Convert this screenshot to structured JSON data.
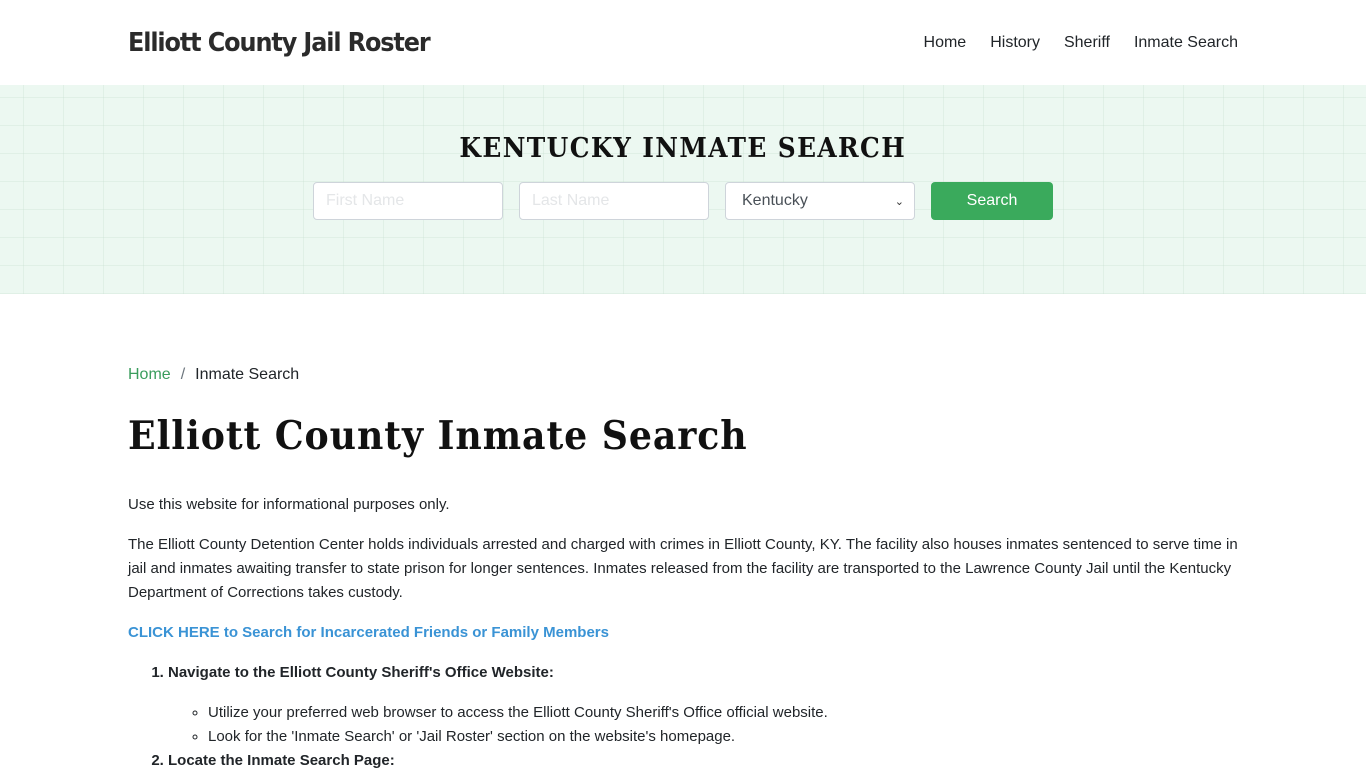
{
  "header": {
    "brand": "Elliott County Jail Roster",
    "nav": [
      {
        "label": "Home"
      },
      {
        "label": "History"
      },
      {
        "label": "Sheriff"
      },
      {
        "label": "Inmate Search"
      }
    ]
  },
  "hero": {
    "title": "KENTUCKY INMATE SEARCH",
    "first_name_placeholder": "First Name",
    "last_name_placeholder": "Last Name",
    "state_selected": "Kentucky",
    "search_label": "Search",
    "accent_color": "#3aaa5c",
    "background_color": "#ecf8f1"
  },
  "breadcrumb": {
    "home": "Home",
    "separator": "/",
    "current": "Inmate Search"
  },
  "main": {
    "title": "Elliott County Inmate Search",
    "paragraphs": [
      "Use this website for informational purposes only.",
      "The Elliott County Detention Center holds individuals arrested and charged with crimes in Elliott County, KY. The facility also houses inmates sentenced to serve time in jail and inmates awaiting transfer to state prison for longer sentences. Inmates released from the facility are transported to the Lawrence County Jail until the Kentucky Department of Corrections takes custody."
    ],
    "cta_link": "CLICK HERE to Search for Incarcerated Friends or Family Members",
    "steps": [
      {
        "title": "Navigate to the Elliott County Sheriff's Office Website:",
        "items": [
          "Utilize your preferred web browser to access the Elliott County Sheriff's Office official website.",
          "Look for the 'Inmate Search' or 'Jail Roster' section on the website's homepage."
        ]
      },
      {
        "title": "Locate the Inmate Search Page:"
      }
    ]
  }
}
